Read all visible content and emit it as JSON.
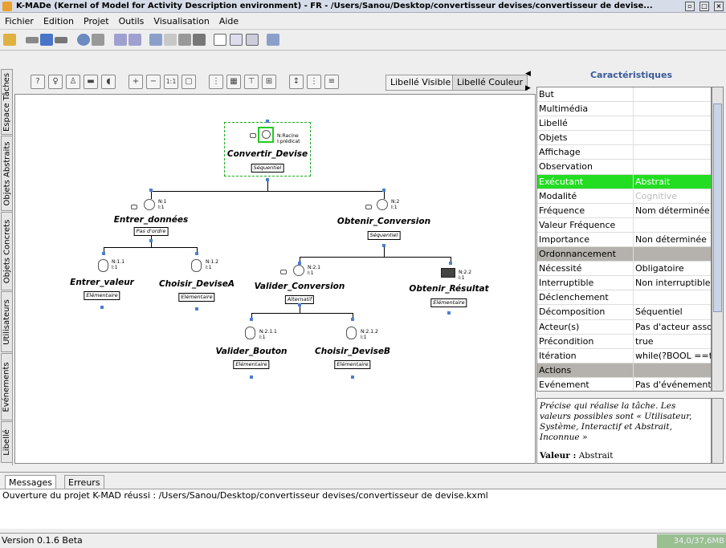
{
  "window": {
    "title": "K-MADe (Kernel of Model for Activity Description environment) - FR - /Users/Sanou/Desktop/convertisseur devises/convertisseur de devise..."
  },
  "menu": [
    "Fichier",
    "Edition",
    "Projet",
    "Outils",
    "Visualisation",
    "Aide"
  ],
  "side_tabs": [
    "Espace Tâches",
    "Objets Abstraits",
    "Objets Concrets",
    "Utilisateurs",
    "Evénements",
    "Libellé"
  ],
  "canvas_toolbar": {
    "libelle_visible": "Libellé Visible",
    "libelle_couleur": "Libellé Couleur"
  },
  "tree": {
    "root": {
      "name": "Convertir_Devise",
      "num": "N:Racine",
      "iter": "I:prédicat",
      "decomp": "Séquentiel"
    },
    "n1": {
      "name": "Entrer_données",
      "num": "N:1",
      "iter": "I:1",
      "decomp": "Pas d'ordre"
    },
    "n2": {
      "name": "Obtenir_Conversion",
      "num": "N:2",
      "iter": "I:1",
      "decomp": "Séquentiel"
    },
    "n11": {
      "name": "Entrer_valeur",
      "num": "N:1.1",
      "iter": "I:1",
      "decomp": "Elémentaire"
    },
    "n12": {
      "name": "Choisir_DeviseA",
      "num": "N:1.2",
      "iter": "I:1",
      "decomp": "Elémentaire"
    },
    "n21": {
      "name": "Valider_Conversion",
      "num": "N:2.1",
      "iter": "I:1",
      "decomp": "Alternatif"
    },
    "n22": {
      "name": "Obtenir_Résultat",
      "num": "N:2.2",
      "iter": "I:1",
      "decomp": "Elémentaire"
    },
    "n211": {
      "name": "Valider_Bouton",
      "num": "N:2.1.1",
      "iter": "I:1",
      "decomp": "Elémentaire"
    },
    "n212": {
      "name": "Choisir_DeviseB",
      "num": "N:2.1.2",
      "iter": "I:1",
      "decomp": "Elémentaire"
    }
  },
  "properties_panel": {
    "title": "Caractéristiques",
    "rows": [
      {
        "key": "But",
        "value": ""
      },
      {
        "key": "Multimédia",
        "value": ""
      },
      {
        "key": "Libellé",
        "value": ""
      },
      {
        "key": "Objets",
        "value": ""
      },
      {
        "key": "Affichage",
        "value": ""
      },
      {
        "key": "Observation",
        "value": ""
      },
      {
        "key": "Exécutant",
        "value": "Abstrait",
        "style": "sel"
      },
      {
        "key": "Modalité",
        "value": "Cognitive",
        "style": "dim"
      },
      {
        "key": "Fréquence",
        "value": "Nom déterminée"
      },
      {
        "key": "Valeur Fréquence",
        "value": ""
      },
      {
        "key": "Importance",
        "value": "Non déterminée"
      },
      {
        "key": "Ordonnancement",
        "value": "",
        "style": "sec"
      },
      {
        "key": "Nécessité",
        "value": "Obligatoire"
      },
      {
        "key": "Interruptible",
        "value": "Non interruptible"
      },
      {
        "key": "Déclenchement",
        "value": ""
      },
      {
        "key": "Décomposition",
        "value": "Séquentiel"
      },
      {
        "key": "Acteur(s)",
        "value": "Pas d'acteur assoc"
      },
      {
        "key": "Précondition",
        "value": "true"
      },
      {
        "key": "Itération",
        "value": "while(?BOOL ==tr"
      },
      {
        "key": "Actions",
        "value": "",
        "style": "sec"
      },
      {
        "key": "Evénement",
        "value": "Pas d'événement a"
      }
    ],
    "description": "Précise qui réalise la tâche. Les valeurs possibles sont « Utilisateur, Système, Interactif et Abstrait, Inconnue »",
    "value_label": "Valeur :",
    "value_text": "Abstrait"
  },
  "bottom_tabs": [
    "Messages",
    "Erreurs"
  ],
  "console_message": "Ouverture du projet K-MAD réussi : /Users/Sanou/Desktop/convertisseur devises/convertisseur de devise.kxml",
  "status": {
    "version": "Version 0.1.6 Beta",
    "memory": "34,0/37,6MB"
  }
}
